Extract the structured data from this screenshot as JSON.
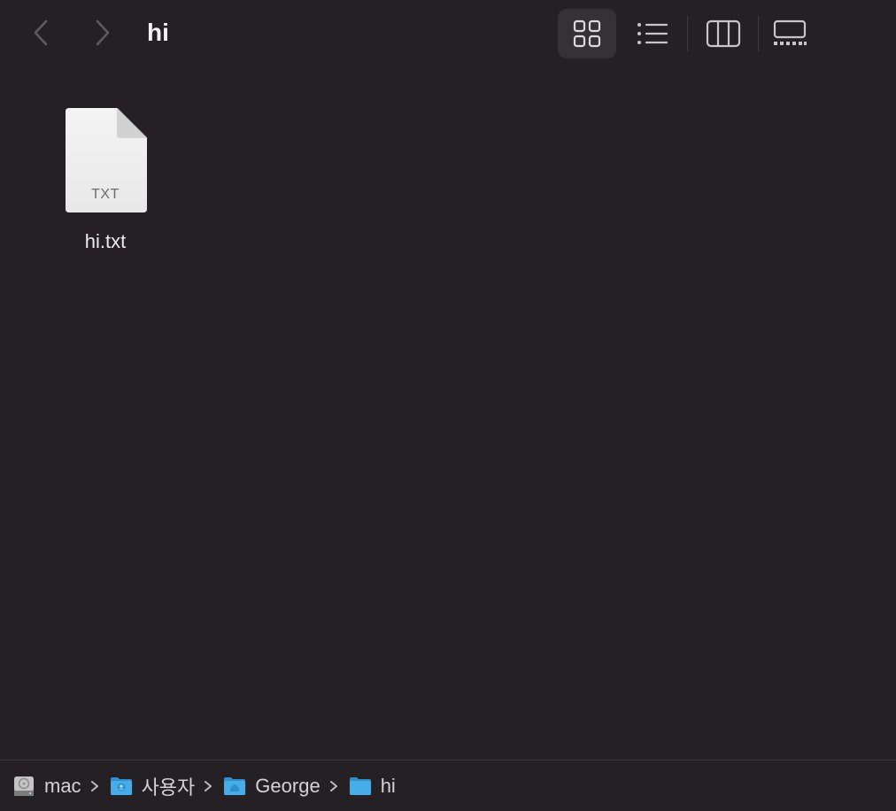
{
  "window": {
    "title": "hi"
  },
  "toolbar": {
    "back_icon": "chevron-left-icon",
    "forward_icon": "chevron-right-icon",
    "views": [
      {
        "name": "icon-view",
        "icon": "grid-icon",
        "selected": true
      },
      {
        "name": "list-view",
        "icon": "list-icon",
        "selected": false
      },
      {
        "name": "column-view",
        "icon": "columns-icon",
        "selected": false
      },
      {
        "name": "gallery-view",
        "icon": "gallery-icon",
        "selected": false
      }
    ]
  },
  "files": [
    {
      "name": "hi.txt",
      "ext_label": "TXT",
      "icon": "text-document-icon"
    }
  ],
  "pathbar": {
    "crumbs": [
      {
        "label": "mac",
        "icon": "hard-drive-icon"
      },
      {
        "label": "사용자",
        "icon": "users-folder-icon"
      },
      {
        "label": "George",
        "icon": "home-folder-icon"
      },
      {
        "label": "hi",
        "icon": "folder-icon"
      }
    ]
  },
  "colors": {
    "background": "#242024",
    "selected_view_bg": "#353135",
    "folder_blue": "#3aa9e8"
  }
}
